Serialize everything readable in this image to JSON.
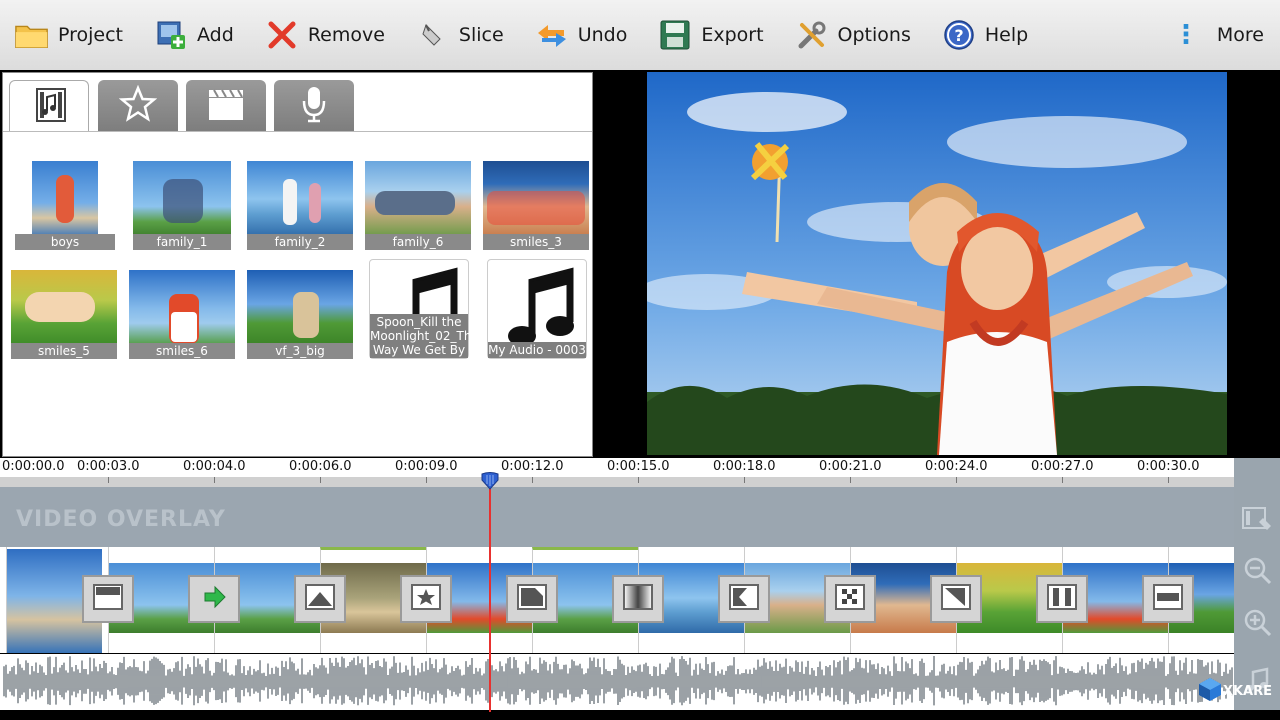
{
  "toolbar": {
    "project": "Project",
    "add": "Add",
    "remove": "Remove",
    "slice": "Slice",
    "undo": "Undo",
    "export": "Export",
    "options": "Options",
    "help": "Help",
    "more": "More"
  },
  "library": {
    "tabs": [
      "media-icon",
      "star-icon",
      "clapper-icon",
      "microphone-icon"
    ],
    "items": [
      {
        "label": "boys"
      },
      {
        "label": "family_1"
      },
      {
        "label": "family_2"
      },
      {
        "label": "family_6"
      },
      {
        "label": "smiles_3"
      },
      {
        "label": "smiles_5"
      },
      {
        "label": "smiles_6"
      },
      {
        "label": "vf_3_big"
      },
      {
        "label": "Spoon_Kill the Moonlight_02_The Way We Get By"
      },
      {
        "label": "My Audio - 0003"
      }
    ]
  },
  "timeline": {
    "ticks": [
      "0:00:00.0",
      "0:00:03.0",
      "0:00:04.0",
      "0:00:06.0",
      "0:00:09.0",
      "0:00:12.0",
      "0:00:15.0",
      "0:00:18.0",
      "0:00:21.0",
      "0:00:24.0",
      "0:00:27.0",
      "0:00:30.0"
    ],
    "overlay_label": "VIDEO OVERLAY"
  },
  "watermark": "XKARE",
  "colors": {
    "accent": "#2b8fd6",
    "playhead": "#e8312f",
    "overlay_track": "#9ba6b0",
    "selected_clip": "#8ab84a"
  }
}
